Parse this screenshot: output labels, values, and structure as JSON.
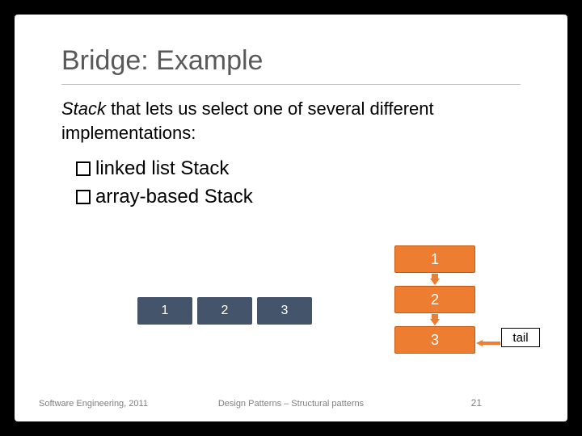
{
  "title": "Bridge: Example",
  "body": {
    "lead_em": "Stack",
    "lead_rest": " that lets us select one of several different implementations:"
  },
  "bullets": [
    "linked list Stack",
    "array-based Stack"
  ],
  "array_cells": [
    "1",
    "2",
    "3"
  ],
  "linked_list_nodes": [
    "1",
    "2",
    "3"
  ],
  "tail_label": "tail",
  "footer": {
    "left": "Software Engineering, 2011",
    "center": "Design Patterns – Structural patterns",
    "page": "21"
  },
  "colors": {
    "array_bg": "#44546a",
    "node_bg": "#ed7d31",
    "node_border": "#c55a11"
  }
}
